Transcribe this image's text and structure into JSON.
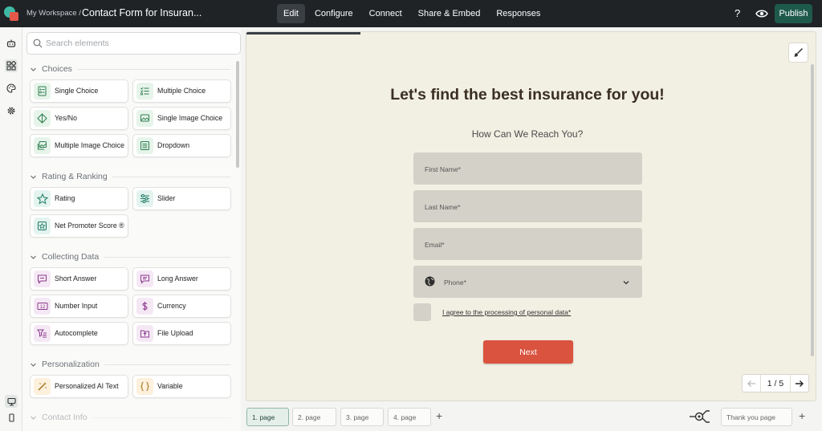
{
  "header": {
    "workspace": "My Workspace /",
    "form_title": "Contact Form for Insuran...",
    "tabs": [
      "Edit",
      "Configure",
      "Connect",
      "Share & Embed",
      "Responses"
    ],
    "active_tab": "Edit",
    "help": "?",
    "publish": "Publish"
  },
  "sidebar": {
    "search_placeholder": "Search elements",
    "sections": [
      {
        "title": "Choices",
        "items": [
          "Single Choice",
          "Multiple Choice",
          "Yes/No",
          "Single Image Choice",
          "Multiple Image Choice",
          "Dropdown"
        ]
      },
      {
        "title": "Rating & Ranking",
        "items": [
          "Rating",
          "Slider",
          "Net Promoter Score ®"
        ]
      },
      {
        "title": "Collecting Data",
        "items": [
          "Short Answer",
          "Long Answer",
          "Number Input",
          "Currency",
          "Autocomplete",
          "File Upload"
        ]
      },
      {
        "title": "Personalization",
        "items": [
          "Personalized AI Text",
          "Variable"
        ]
      },
      {
        "title": "Contact Info",
        "items": []
      }
    ]
  },
  "form": {
    "heading": "Let's find the best insurance for you!",
    "subheading": "How Can We Reach You?",
    "fields": [
      "First Name*",
      "Last Name*",
      "Email*",
      "Phone*"
    ],
    "consent": "I agree to the processing of personal data*",
    "next": "Next",
    "pagination": "1 / 5"
  },
  "pages": {
    "tabs": [
      "1. page",
      "2. page",
      "3. page",
      "4. page"
    ],
    "thank_you": "Thank you page",
    "add": "+"
  },
  "colors": {
    "topbar": "#1f2326",
    "publish": "#1e5a4c",
    "canvas": "#f2efe3",
    "field": "#d4d1c8",
    "next": "#d9533f",
    "heading": "#3b2f23"
  }
}
